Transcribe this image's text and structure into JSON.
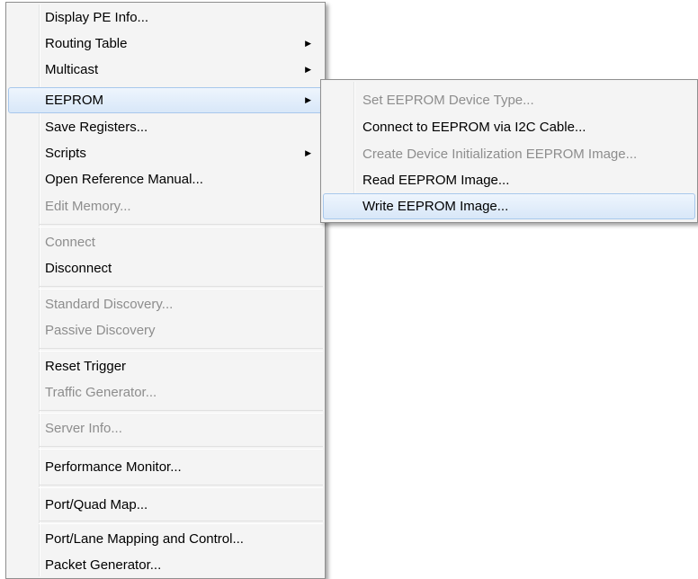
{
  "main_menu": {
    "items": [
      {
        "label": "Display PE Info...",
        "enabled": true
      },
      {
        "label": "Routing Table",
        "enabled": true,
        "submenu": true
      },
      {
        "label": "Multicast",
        "enabled": true,
        "submenu": true
      },
      {
        "label": "EEPROM",
        "enabled": true,
        "submenu": true,
        "highlighted": true
      },
      {
        "label": "Save Registers...",
        "enabled": true
      },
      {
        "label": "Scripts",
        "enabled": true,
        "submenu": true
      },
      {
        "label": "Open Reference Manual...",
        "enabled": true
      },
      {
        "label": "Edit Memory...",
        "enabled": false
      },
      {
        "label": "Connect",
        "enabled": false
      },
      {
        "label": "Disconnect",
        "enabled": true
      },
      {
        "label": "Standard Discovery...",
        "enabled": false
      },
      {
        "label": "Passive Discovery",
        "enabled": false
      },
      {
        "label": "Reset Trigger",
        "enabled": true
      },
      {
        "label": "Traffic Generator...",
        "enabled": false
      },
      {
        "label": "Server Info...",
        "enabled": false
      },
      {
        "label": "Performance Monitor...",
        "enabled": true
      },
      {
        "label": "Port/Quad Map...",
        "enabled": true
      },
      {
        "label": "Port/Lane Mapping and Control...",
        "enabled": true
      },
      {
        "label": "Packet Generator...",
        "enabled": true
      }
    ],
    "submenu_arrow_icon": "triangle-right-icon"
  },
  "eeprom_submenu": {
    "items": [
      {
        "label": "Set EEPROM Device Type...",
        "enabled": false
      },
      {
        "label": "Connect to EEPROM via I2C Cable...",
        "enabled": true
      },
      {
        "label": "Create Device Initialization EEPROM Image...",
        "enabled": false
      },
      {
        "label": "Read EEPROM Image...",
        "enabled": true
      },
      {
        "label": "Write EEPROM Image...",
        "enabled": true,
        "highlighted": true
      }
    ]
  },
  "colors": {
    "menu_background": "#f4f4f4",
    "disabled_text": "#8d8d8d",
    "highlight_border": "#a8c8ec"
  }
}
